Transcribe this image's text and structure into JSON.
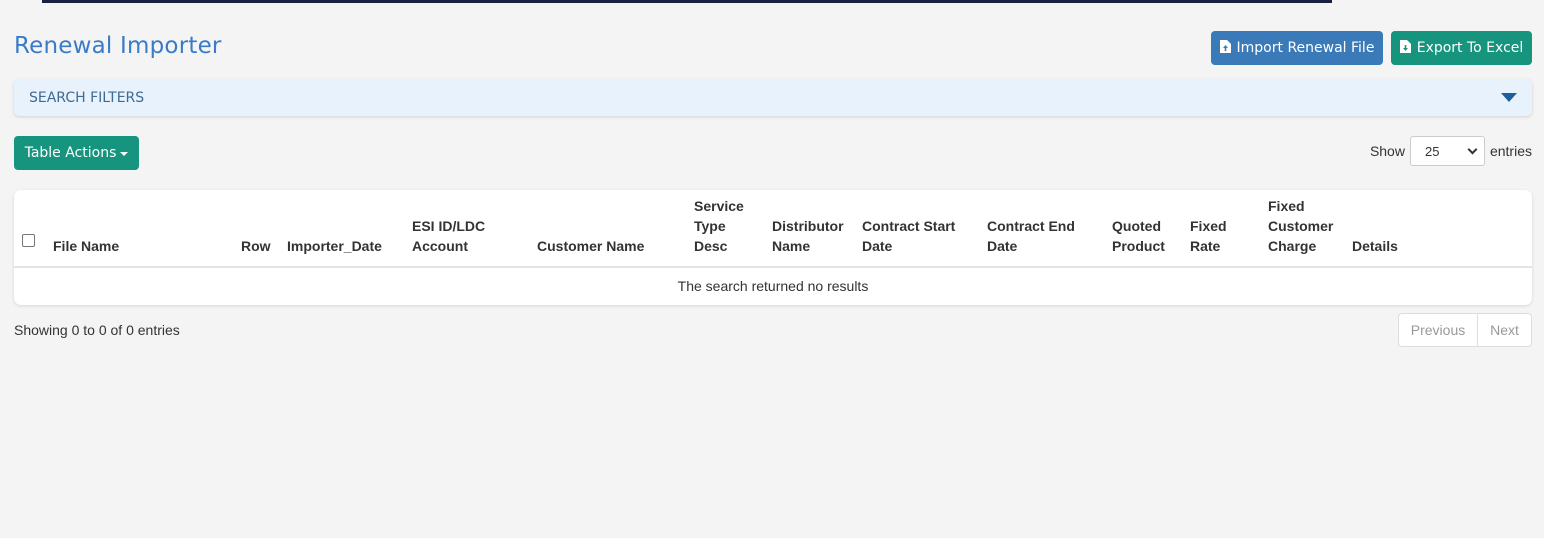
{
  "page": {
    "title": "Renewal Importer"
  },
  "toolbar": {
    "import_label": "Import Renewal File",
    "export_label": "Export To Excel",
    "import_icon": "file-upload-icon",
    "export_icon": "file-download-icon"
  },
  "filters": {
    "label": "SEARCH FILTERS",
    "expanded": false
  },
  "table_actions": {
    "label": "Table Actions"
  },
  "length": {
    "show_label": "Show",
    "selected": "25",
    "entries_label": "entries"
  },
  "table": {
    "columns": [
      "File Name",
      "Row",
      "Importer_Date",
      "ESI ID/LDC Account",
      "Customer Name",
      "Service Type Desc",
      "Distributor Name",
      "Contract Start Date",
      "Contract End Date",
      "Quoted Product",
      "Fixed Rate",
      "Fixed Customer Charge",
      "Details"
    ],
    "empty_message": "The search returned no results"
  },
  "footer": {
    "info": "Showing 0 to 0 of 0 entries",
    "previous": "Previous",
    "next": "Next"
  },
  "colors": {
    "title": "#3a7bc8",
    "import_button": "#3a7ab8",
    "export_button": "#16947e",
    "filters_bg": "#e8f2fc",
    "page_bg": "#f4f4f4"
  }
}
